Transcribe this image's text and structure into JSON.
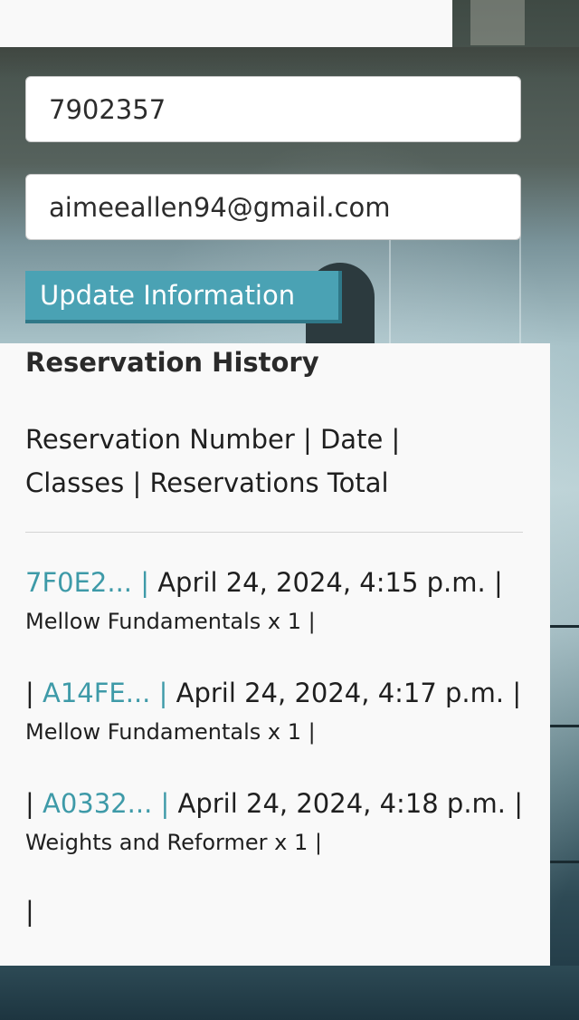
{
  "profile": {
    "phone_value": "7902357",
    "email_value": "aimeeallen94@gmail.com",
    "update_button_label": "Update Information"
  },
  "history": {
    "title": "Reservation History",
    "header": "Reservation Number | Date | Classes | Reservations Total",
    "entries": [
      {
        "prefix": "",
        "reservation_link": "7F0E2... |",
        "date": " April 24, 2024, 4:15 p.m. |",
        "classes": "Mellow Fundamentals x 1 |"
      },
      {
        "prefix": "| ",
        "reservation_link": "A14FE... |",
        "date": " April 24, 2024, 4:17 p.m. |",
        "classes": "Mellow Fundamentals x 1 |"
      },
      {
        "prefix": "| ",
        "reservation_link": "A0332... |",
        "date": " April 24, 2024, 4:18 p.m. |",
        "classes": "Weights and Reformer x 1 |"
      }
    ],
    "trailing": "|"
  },
  "colors": {
    "accent": "#3e9aa8",
    "button": "#4aa2b4",
    "card": "#f9f9f9"
  }
}
